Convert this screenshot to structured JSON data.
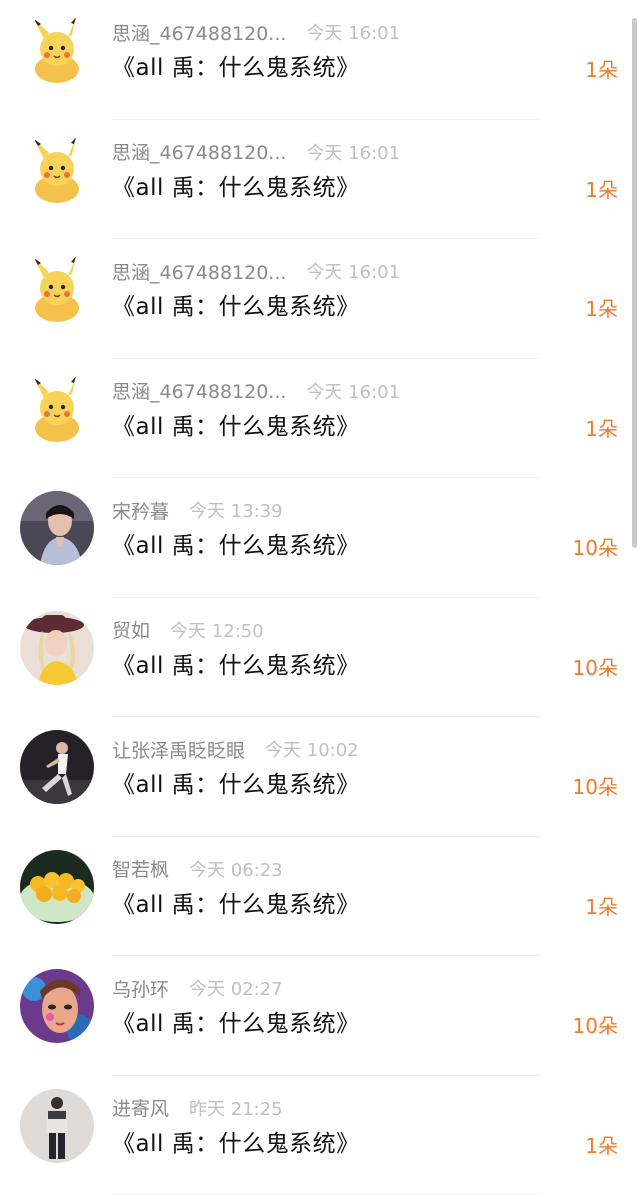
{
  "title_label": "《all 禹：什么鬼系统》",
  "colors": {
    "username": "#8a8a8a",
    "timestamp": "#c0c0c0",
    "title": "#111111",
    "count": "#f07a2c"
  },
  "rows": [
    {
      "user": "思涵_467488120...",
      "time": "今天 16:01",
      "title": "《all 禹：什么鬼系统》",
      "count": "1朵",
      "avatar": "pikachu-avatar"
    },
    {
      "user": "思涵_467488120...",
      "time": "今天 16:01",
      "title": "《all 禹：什么鬼系统》",
      "count": "1朵",
      "avatar": "pikachu-avatar"
    },
    {
      "user": "思涵_467488120...",
      "time": "今天 16:01",
      "title": "《all 禹：什么鬼系统》",
      "count": "1朵",
      "avatar": "pikachu-avatar"
    },
    {
      "user": "思涵_467488120...",
      "time": "今天 16:01",
      "title": "《all 禹：什么鬼系统》",
      "count": "1朵",
      "avatar": "pikachu-avatar"
    },
    {
      "user": "宋矜暮",
      "time": "今天 13:39",
      "title": "《all 禹：什么鬼系统》",
      "count": "10朵",
      "avatar": "portrait-avatar"
    },
    {
      "user": "贸如",
      "time": "今天 12:50",
      "title": "《all 禹：什么鬼系统》",
      "count": "10朵",
      "avatar": "girl-hat-avatar"
    },
    {
      "user": "让张泽禹眨眨眼",
      "time": "今天 10:02",
      "title": "《all 禹：什么鬼系统》",
      "count": "10朵",
      "avatar": "dancer-avatar"
    },
    {
      "user": "智若枫",
      "time": "今天 06:23",
      "title": "《all 禹：什么鬼系统》",
      "count": "1朵",
      "avatar": "food-avatar"
    },
    {
      "user": "乌孙环",
      "time": "今天 02:27",
      "title": "《all 禹：什么鬼系统》",
      "count": "10朵",
      "avatar": "painted-face-avatar"
    },
    {
      "user": "进寄风",
      "time": "昨天 21:25",
      "title": "《all 禹：什么鬼系统》",
      "count": "1朵",
      "avatar": "standing-person-avatar"
    }
  ]
}
